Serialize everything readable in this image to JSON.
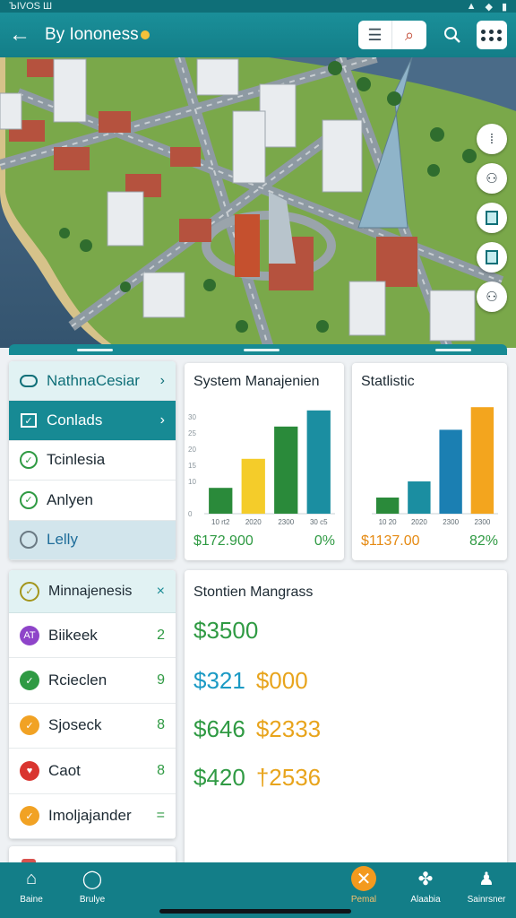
{
  "status_bar": {
    "left": "ЪIVOS Ш",
    "right_icons": [
      "signal-icon",
      "wifi-icon",
      "battery-icon"
    ]
  },
  "app_bar": {
    "title": "By Iononess",
    "icons": [
      "back-arrow-icon",
      "list-icon",
      "location-search-icon",
      "search-icon",
      "grid-dots-icon"
    ]
  },
  "map": {
    "tools": [
      "dots-menu-icon",
      "profile-icon",
      "panel-icon",
      "panel-icon",
      "profile-icon"
    ]
  },
  "menu": {
    "items": [
      {
        "label": "NathnaCesiar",
        "icon": "link-icon",
        "state": "header"
      },
      {
        "label": "Conlads",
        "icon": "checkbox-icon",
        "state": "active"
      },
      {
        "label": "Tcinlesia",
        "icon": "check-circle-icon",
        "state": "normal"
      },
      {
        "label": "Anlyen",
        "icon": "check-circle-icon",
        "state": "normal"
      },
      {
        "label": "Lelly",
        "icon": "ring-icon",
        "state": "selected"
      }
    ]
  },
  "chart_cards": [
    {
      "title": "System Manajenien",
      "money": "$172.900",
      "pct": "0%",
      "money_color": "#2f9a43",
      "pct_color": "#2f9a43"
    },
    {
      "title": "Statlistic",
      "money": "$1137.00",
      "pct": "82%",
      "money_color": "#e58a13",
      "pct_color": "#2f9a43"
    }
  ],
  "chart_data": [
    {
      "type": "bar",
      "title": "System Manajenien",
      "categories": [
        "10 rt2",
        "2020",
        "2300",
        "30 c5"
      ],
      "values": [
        8,
        17,
        27,
        32
      ],
      "colors": [
        "#2a8a3a",
        "#f4cc2a",
        "#2a8a3a",
        "#1b8ea1"
      ],
      "yticks": [
        "0",
        "10",
        "15",
        "20",
        "25",
        "30"
      ],
      "ylim": [
        0,
        35
      ]
    },
    {
      "type": "bar",
      "title": "Statlistic",
      "categories": [
        "10 20",
        "2020",
        "2300",
        "2300"
      ],
      "values": [
        5,
        10,
        26,
        33
      ],
      "colors": [
        "#2a8a3a",
        "#1b8ea1",
        "#1b7fb2",
        "#f3a51e"
      ],
      "ylim": [
        0,
        35
      ]
    }
  ],
  "list": {
    "header": "Minnajenesis",
    "items": [
      {
        "label": "Biikeek",
        "count": "2",
        "badge_color": "#8e44c9",
        "badge_glyph": "AT"
      },
      {
        "label": "Rcieclen",
        "count": "9",
        "badge_color": "#2f9a43",
        "badge_glyph": "✓"
      },
      {
        "label": "Sjoseck",
        "count": "8",
        "badge_color": "#f1a224",
        "badge_glyph": "✓"
      },
      {
        "label": "Caot",
        "count": "8",
        "badge_color": "#d9352f",
        "badge_glyph": "♥"
      },
      {
        "label": "Imoljajander",
        "count": "=",
        "badge_color": "#f1a224",
        "badge_glyph": "✓"
      }
    ]
  },
  "stats": {
    "title": "Stontien Mangrass",
    "lines": [
      [
        {
          "text": "$3500",
          "color": "#2f9a43"
        }
      ],
      [
        {
          "text": "$321",
          "color": "#1b9ac4"
        },
        {
          "text": "$000",
          "color": "#e8a41c"
        }
      ],
      [
        {
          "text": "$646",
          "color": "#2f9a43"
        },
        {
          "text": "$2333",
          "color": "#e8a41c"
        }
      ],
      [
        {
          "text": "$420",
          "color": "#2f9a43"
        },
        {
          "text": "†2536",
          "color": "#e8a41c"
        }
      ]
    ]
  },
  "bottom_nav": [
    {
      "label": "Baine",
      "icon": "home-icon",
      "active": false
    },
    {
      "label": "Brulye",
      "icon": "globe-icon",
      "active": false
    },
    {
      "label": "Pemal",
      "icon": "tools-icon",
      "active": true
    },
    {
      "label": "Alaabia",
      "icon": "fan-icon",
      "active": false
    },
    {
      "label": "Sainrsner",
      "icon": "user-icon",
      "active": false
    }
  ]
}
